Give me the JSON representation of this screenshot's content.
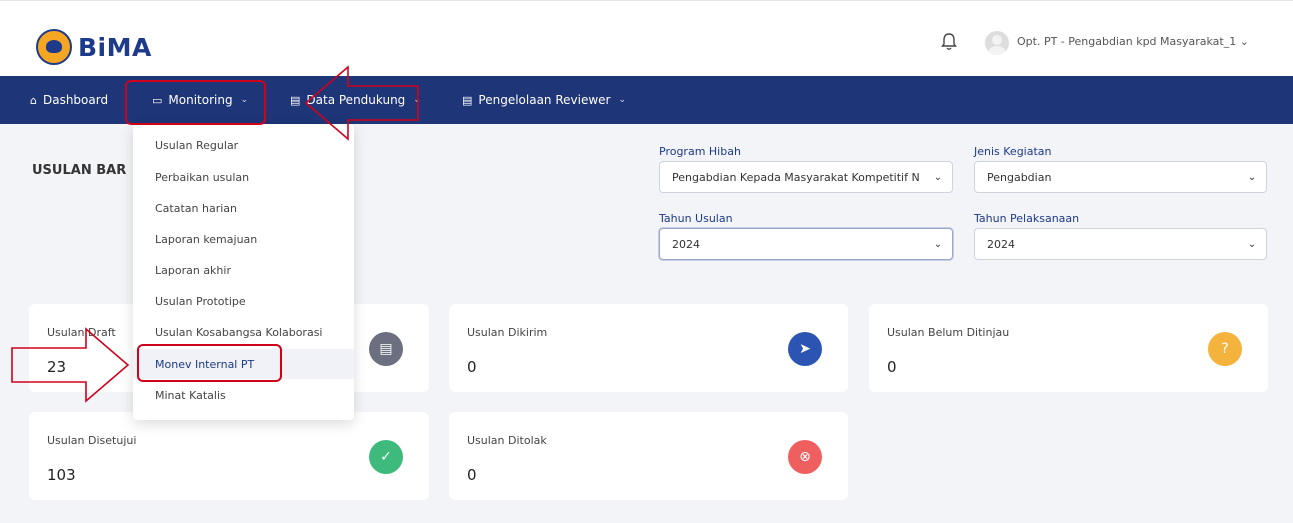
{
  "header": {
    "logo_text": "BiMA",
    "user_name": "Opt. PT - Pengabdian kpd Masyarakat_1",
    "user_chevron": "⌄"
  },
  "navbar": {
    "items": [
      {
        "label": "Dashboard",
        "icon": "home-icon",
        "glyph": "⌂"
      },
      {
        "label": "Monitoring",
        "icon": "monitor-icon",
        "glyph": "▭",
        "chevron": "⌄"
      },
      {
        "label": "Data Pendukung",
        "icon": "file-icon",
        "glyph": "▤",
        "chevron": "⌄"
      },
      {
        "label": "Pengelolaan Reviewer",
        "icon": "file-icon",
        "glyph": "▤",
        "chevron": "⌄"
      }
    ]
  },
  "page": {
    "title": "USULAN BAR"
  },
  "filters": {
    "program_hibah": {
      "label": "Program Hibah",
      "value": "Pengabdian Kepada Masyarakat Kompetitif N"
    },
    "jenis_kegiatan": {
      "label": "Jenis Kegiatan",
      "value": "Pengabdian"
    },
    "tahun_usulan": {
      "label": "Tahun Usulan",
      "value": "2024"
    },
    "tahun_pelaksanaan": {
      "label": "Tahun Pelaksanaan",
      "value": "2024"
    },
    "chevron": "⌄"
  },
  "cards": [
    {
      "label": "Usulan Draft",
      "value": "23",
      "icon": "document-icon",
      "glyph": "▤",
      "color": "#6b6f80"
    },
    {
      "label": "Usulan Dikirim",
      "value": "0",
      "icon": "send-icon",
      "glyph": "➤",
      "color": "#2c55b3"
    },
    {
      "label": "Usulan Belum Ditinjau",
      "value": "0",
      "icon": "question-icon",
      "glyph": "?",
      "color": "#f3b33d"
    },
    {
      "label": "Usulan Disetujui",
      "value": "103",
      "icon": "check-icon",
      "glyph": "✓",
      "color": "#3dba7c"
    },
    {
      "label": "Usulan Ditolak",
      "value": "0",
      "icon": "x-circle-icon",
      "glyph": "⊗",
      "color": "#ef5f5f"
    }
  ],
  "dropdown": {
    "items": [
      {
        "label": "Usulan Regular"
      },
      {
        "label": "Perbaikan usulan"
      },
      {
        "label": "Catatan harian"
      },
      {
        "label": "Laporan kemajuan"
      },
      {
        "label": "Laporan akhir"
      },
      {
        "label": "Usulan Prototipe"
      },
      {
        "label": "Usulan Kosabangsa Kolaborasi"
      },
      {
        "label": "Monev Internal PT"
      },
      {
        "label": "Minat Katalis"
      }
    ]
  },
  "colors": {
    "nav_bg": "#1e3577",
    "brand": "#1e3a8a",
    "annotation": "#d0021b"
  }
}
